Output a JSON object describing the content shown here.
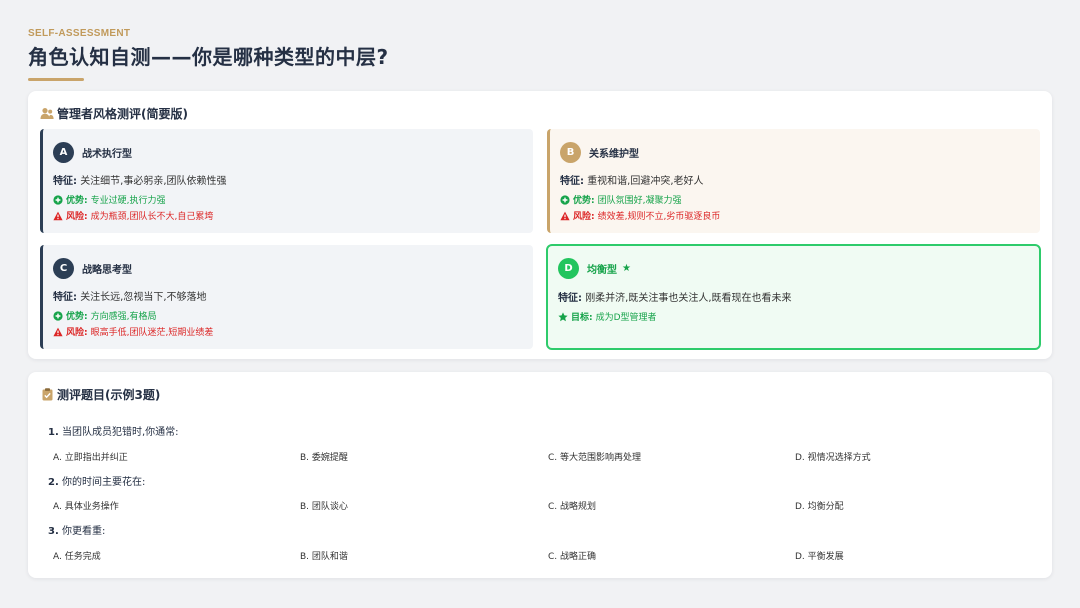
{
  "header": {
    "eyebrow": "SELF-ASSESSMENT",
    "title": "角色认知自测——你是哪种类型的中层?"
  },
  "style_section": {
    "heading": "管理者风格测评(简要版)",
    "cards": [
      {
        "letter": "A",
        "title": "战术执行型",
        "trait_label": "特征:",
        "trait": "关注细节,事必躬亲,团队依赖性强",
        "adv_label": "优势:",
        "adv": "专业过硬,执行力强",
        "risk_label": "风险:",
        "risk": "成为瓶颈,团队长不大,自己累垮"
      },
      {
        "letter": "B",
        "title": "关系维护型",
        "trait_label": "特征:",
        "trait": "重视和谐,回避冲突,老好人",
        "adv_label": "优势:",
        "adv": "团队氛围好,凝聚力强",
        "risk_label": "风险:",
        "risk": "绩效差,规则不立,劣币驱逐良币"
      },
      {
        "letter": "C",
        "title": "战略思考型",
        "trait_label": "特征:",
        "trait": "关注长远,忽视当下,不够落地",
        "adv_label": "优势:",
        "adv": "方向感强,有格局",
        "risk_label": "风险:",
        "risk": "眼高手低,团队迷茫,短期业绩差"
      },
      {
        "letter": "D",
        "title": "均衡型",
        "trait_label": "特征:",
        "trait": "刚柔并济,既关注事也关注人,既看现在也看未来",
        "goal_label": "目标:",
        "goal": "成为D型管理者"
      }
    ]
  },
  "quiz": {
    "heading": "测评题目(示例3题)",
    "questions": [
      {
        "num": "1.",
        "text": "当团队成员犯错时,你通常:",
        "options": [
          "A. 立即指出并纠正",
          "B. 委婉提醒",
          "C. 等大范围影响再处理",
          "D. 视情况选择方式"
        ]
      },
      {
        "num": "2.",
        "text": "你的时间主要花在:",
        "options": [
          "A. 具体业务操作",
          "B. 团队谈心",
          "C. 战略规划",
          "D. 均衡分配"
        ]
      },
      {
        "num": "3.",
        "text": "你更看重:",
        "options": [
          "A. 任务完成",
          "B. 团队和谐",
          "C. 战略正确",
          "D. 平衡发展"
        ]
      }
    ]
  },
  "colors": {
    "navy": "#2c3e55",
    "gold": "#c9a46a",
    "green": "#22c55e",
    "red": "#dc2626"
  }
}
